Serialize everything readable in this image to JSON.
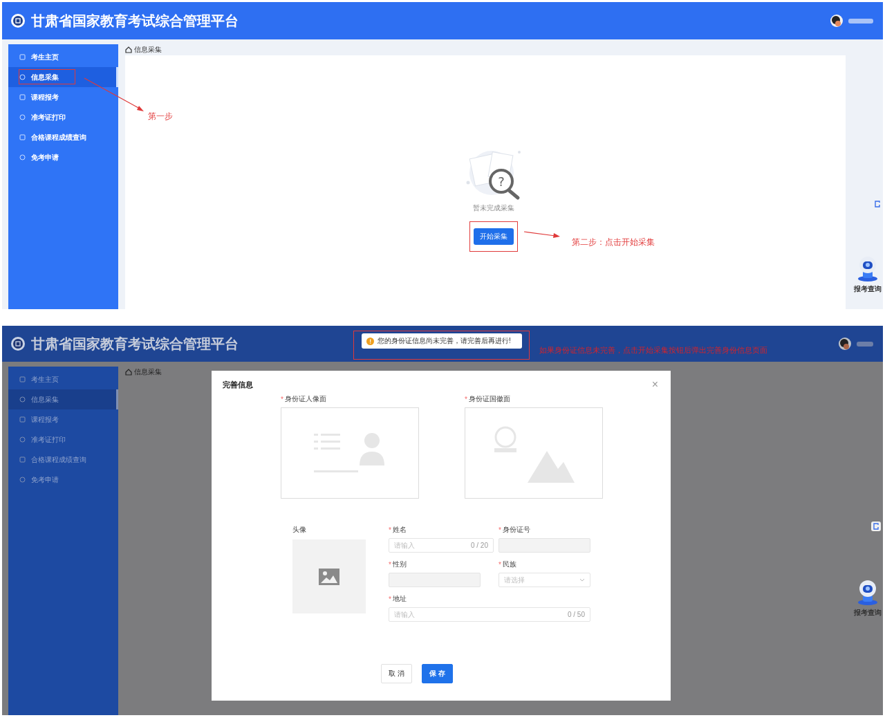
{
  "step_one_screen": {
    "header": {
      "title": "甘肃省国家教育考试综合管理平台"
    },
    "sidebar": {
      "items": [
        {
          "label": "考生主页",
          "selected": false
        },
        {
          "label": "信息采集",
          "selected": true
        },
        {
          "label": "课程报考",
          "selected": false
        },
        {
          "label": "准考证打印",
          "selected": false
        },
        {
          "label": "合格课程成绩查询",
          "selected": false
        },
        {
          "label": "免考申请",
          "selected": false
        }
      ]
    },
    "breadcrumb": "信息采集",
    "empty_state": {
      "glyph": "?",
      "message": "暂未完成采集",
      "button": "开始采集"
    },
    "help_widget": {
      "label": "报考查询"
    },
    "annotations": [
      {
        "text": "第一步"
      },
      {
        "text": "第二步：点击开始采集"
      }
    ]
  },
  "step_two_screen": {
    "header": {
      "title": "甘肃省国家教育考试综合管理平台"
    },
    "toast": {
      "message": "您的身份证信息尚未完善，请完善后再进行!"
    },
    "annotation": {
      "text": "如果身份证信息未完善，点击开始采集按钮后弹出完善身份信息页面"
    },
    "sidebar": {
      "items": [
        {
          "label": "考生主页",
          "selected": false
        },
        {
          "label": "信息采集",
          "selected": true
        },
        {
          "label": "课程报考",
          "selected": false
        },
        {
          "label": "准考证打印",
          "selected": false
        },
        {
          "label": "合格课程成绩查询",
          "selected": false
        },
        {
          "label": "免考申请",
          "selected": false
        }
      ]
    },
    "breadcrumb": "信息采集",
    "modal": {
      "title": "完善信息",
      "close": "×",
      "uploads": [
        {
          "label": "身份证人像面",
          "kind": "portrait",
          "required_mark": "*"
        },
        {
          "label": "身份证国徽面",
          "kind": "emblem",
          "required_mark": "*"
        }
      ],
      "avatar_label": "头像",
      "field_rows": [
        [
          {
            "label": "姓名",
            "kind": "text",
            "required_mark": "*",
            "placeholder": "请输入",
            "counter": "0 / 20"
          },
          {
            "label": "身份证号",
            "kind": "disabled",
            "required_mark": "*"
          }
        ],
        [
          {
            "label": "性别",
            "kind": "disabled",
            "required_mark": "*"
          },
          {
            "label": "民族",
            "kind": "select",
            "required_mark": "*",
            "placeholder": "请选择"
          }
        ],
        [
          {
            "label": "地址",
            "kind": "text",
            "required_mark": "*",
            "placeholder": "请输入",
            "counter": "0 / 50"
          }
        ]
      ],
      "buttons": [
        {
          "label": "取 消",
          "kind": "cancel"
        },
        {
          "label": "保 存",
          "kind": "primary"
        }
      ]
    },
    "help_widget": {
      "label": "报考查询"
    }
  }
}
